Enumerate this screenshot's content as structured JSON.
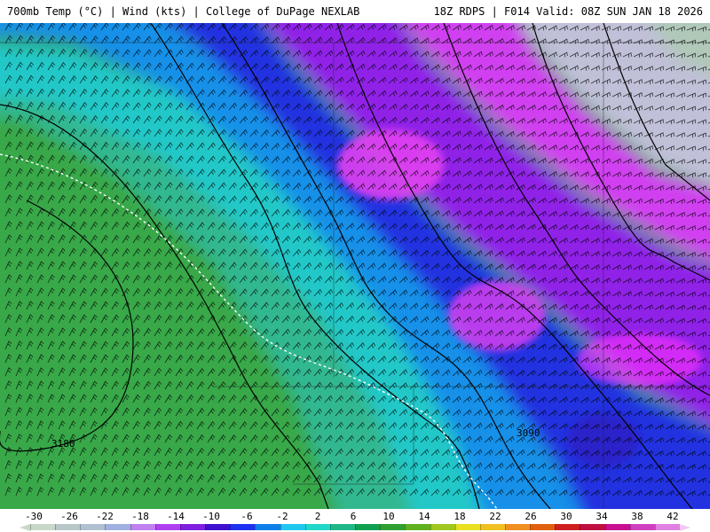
{
  "header": {
    "left_text": "700mb Temp (°C) | Wind (kts) | College of DuPage NEXLAB",
    "right_text": "18Z RDPS | F014 Valid: 08Z SUN JAN 18 2026"
  },
  "map": {
    "contour_labels": [
      "3180",
      "3090"
    ],
    "wind_barb_color": "#000000",
    "freezing_line_color": "#ffffff"
  },
  "legend": {
    "tick_labels": [
      "-30",
      "-26",
      "-22",
      "-18",
      "-14",
      "-10",
      "-6",
      "-2",
      "2",
      "6",
      "10",
      "14",
      "18",
      "22",
      "26",
      "30",
      "34",
      "38",
      "42"
    ],
    "colors": [
      "#c8d8c8",
      "#b8c8c8",
      "#b0c0d0",
      "#a0b0e0",
      "#c080f0",
      "#b040f0",
      "#8020e0",
      "#4010d0",
      "#2030f0",
      "#1080e8",
      "#20c8f0",
      "#20d8c8",
      "#20b888",
      "#10a050",
      "#30a030",
      "#60b020",
      "#a0c820",
      "#e8e020",
      "#f0c020",
      "#f09020",
      "#e06010",
      "#d02020",
      "#c01040",
      "#c81090",
      "#d040c0",
      "#e080e0"
    ]
  }
}
